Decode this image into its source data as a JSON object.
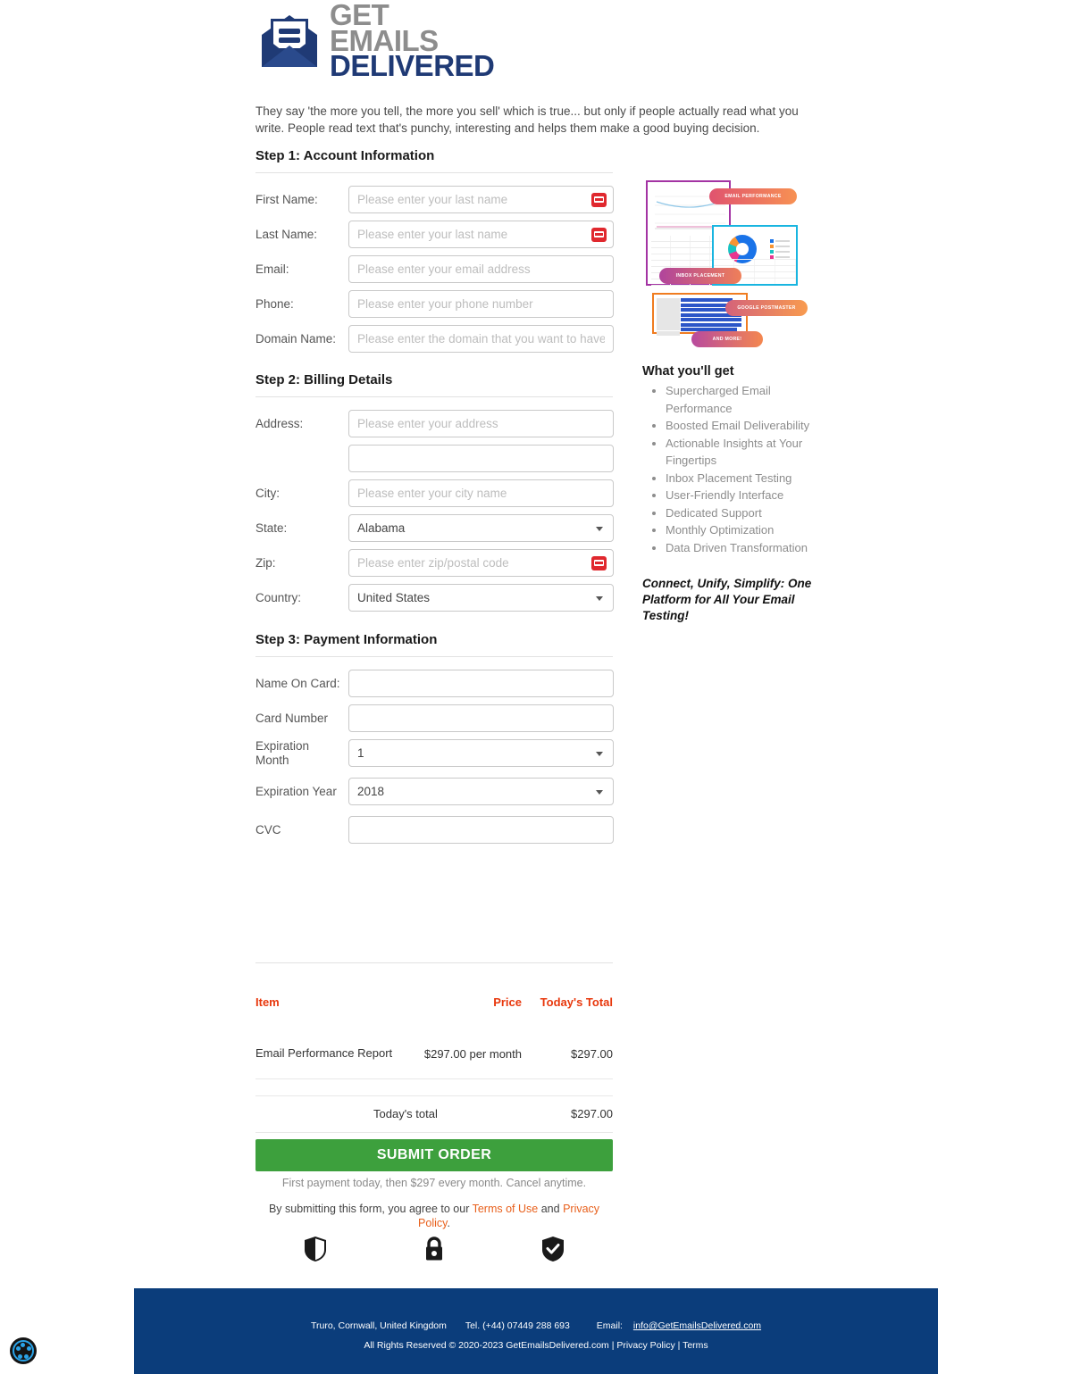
{
  "brand": {
    "logo_line1": "GET EMAILS",
    "logo_line2": "DELIVERED",
    "navy": "#1f3a75",
    "grey": "#8d8d8d"
  },
  "intro": "They say 'the more you tell, the more you sell' which is true... but only if people actually read what you write. People read text that's punchy, interesting and helps them make a good buying decision.",
  "step1": {
    "title": "Step 1: Account Information",
    "fields": [
      {
        "label": "First Name:",
        "placeholder": "Please enter your last name",
        "value": "",
        "has_autofill_icon": true
      },
      {
        "label": "Last Name:",
        "placeholder": "Please enter your last name",
        "value": "",
        "has_autofill_icon": true
      },
      {
        "label": "Email:",
        "placeholder": "Please enter your email address",
        "value": "",
        "has_autofill_icon": false
      },
      {
        "label": "Phone:",
        "placeholder": "Please enter your phone number",
        "value": "",
        "has_autofill_icon": false
      },
      {
        "label": "Domain Name:",
        "placeholder": "Please enter the domain that you want to have checked",
        "value": "",
        "has_autofill_icon": false
      }
    ]
  },
  "step2": {
    "title": "Step 2: Billing Details",
    "address_label": "Address:",
    "address_placeholder": "Please enter your address",
    "address2_placeholder": "",
    "city_label": "City:",
    "city_placeholder": "Please enter your city name",
    "state_label": "State:",
    "state_value": "Alabama",
    "zip_label": "Zip:",
    "zip_placeholder": "Please enter zip/postal code",
    "country_label": "Country:",
    "country_value": "United States"
  },
  "step3": {
    "title": "Step 3: Payment Information",
    "name_on_card_label": "Name On Card:",
    "name_on_card_value": "",
    "card_number_label": "Card Number",
    "card_number_value": "",
    "exp_month_label": "Expiration Month",
    "exp_month_value": "1",
    "exp_year_label": "Expiration Year",
    "exp_year_value": "2018",
    "cvc_label": "CVC",
    "cvc_value": ""
  },
  "order": {
    "header_item": "Item",
    "header_price": "Price",
    "header_total": "Today's Total",
    "row_item": "Email Performance Report",
    "row_price": "$297.00 per month",
    "row_total": "$297.00",
    "total_label": "Today's total",
    "total_value": "$297.00",
    "accent_color": "#e8380d"
  },
  "submit": {
    "label": "SUBMIT ORDER",
    "color": "#3da03d",
    "note": "First payment today, then $297 every month. Cancel anytime.",
    "terms_prefix": "By submitting this form, you agree to our ",
    "terms_link": "Terms of Use",
    "terms_mid": " and ",
    "privacy_link": "Privacy Policy",
    "terms_suffix": "."
  },
  "badges": [
    {
      "name": "shield-half-icon"
    },
    {
      "name": "padlock-icon"
    },
    {
      "name": "shield-check-icon"
    }
  ],
  "sidebar": {
    "collage": {
      "pill_email_performance": "EMAIL PERFORMANCE",
      "pill_inbox_placement": "INBOX PLACEMENT",
      "pill_google_postmaster": "GOOGLE POSTMASTER",
      "pill_and_more": "AND MORE!"
    },
    "heading": "What you'll get",
    "benefits": [
      "Supercharged Email Performance",
      "Boosted Email Deliverability",
      "Actionable Insights at Your Fingertips",
      "Inbox Placement Testing",
      "User-Friendly Interface",
      "Dedicated Support",
      "Monthly Optimization",
      "Data Driven Transformation"
    ],
    "tagline": "Connect, Unify, Simplify: One Platform for All Your Email Testing!"
  },
  "footer": {
    "address": "Truro, Cornwall, United Kingdom",
    "tel": "Tel. (+44) 07449 288 693",
    "email_label": "Email:",
    "email": "info@GetEmailsDelivered.com",
    "copyright": "All Rights Reserved © 2020-2023 GetEmailsDelivered.com | Privacy Policy | Terms",
    "background": "#0b3d7b"
  }
}
